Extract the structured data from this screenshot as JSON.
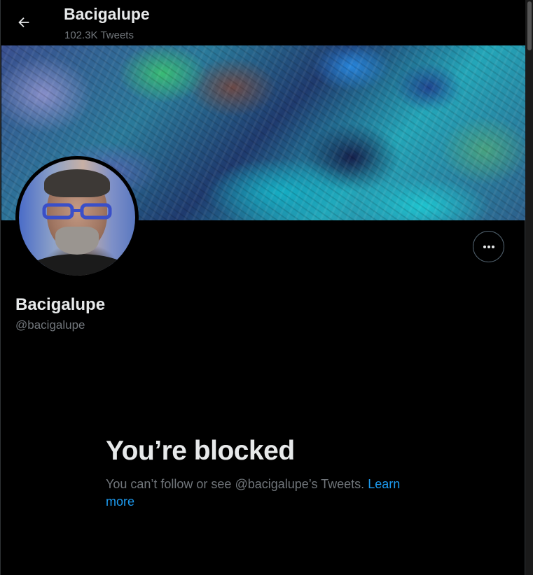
{
  "header": {
    "title": "Bacigalupe",
    "tweet_count": "102.3K Tweets",
    "back_icon": "arrow-left-icon"
  },
  "profile": {
    "name": "Bacigalupe",
    "handle": "@bacigalupe",
    "more_icon": "more-horizontal-icon"
  },
  "blocked": {
    "title": "You’re blocked",
    "message": "You can’t follow or see @bacigalupe’s Tweets.",
    "link_label": "Learn more"
  },
  "colors": {
    "background": "#000000",
    "primary_text": "#e7e9ea",
    "secondary_text": "#71767b",
    "link": "#1d9bf0"
  }
}
